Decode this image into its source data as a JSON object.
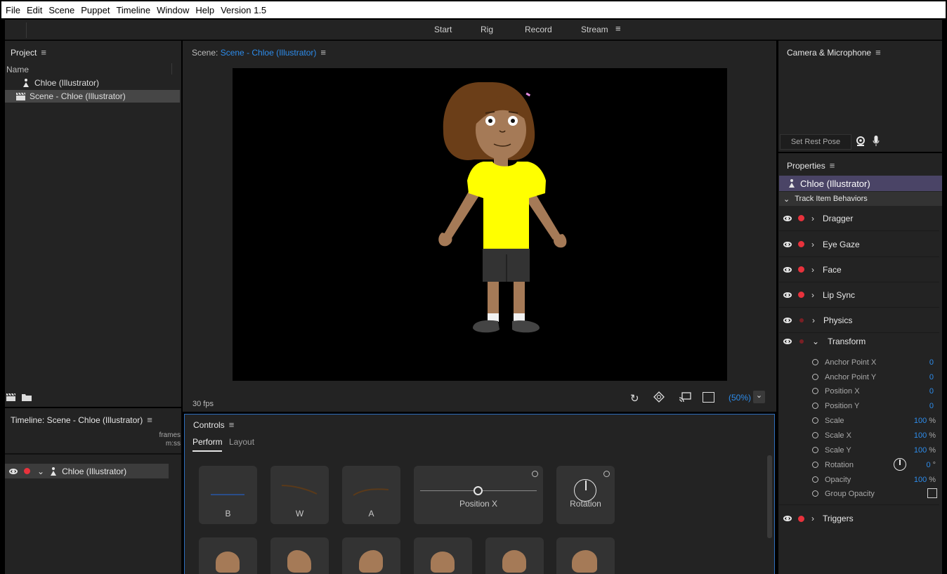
{
  "menubar": {
    "items": [
      "File",
      "Edit",
      "Scene",
      "Puppet",
      "Timeline",
      "Window",
      "Help",
      "Version 1.5"
    ]
  },
  "modes": {
    "start": "Start",
    "rig": "Rig",
    "record": "Record",
    "stream": "Stream"
  },
  "project": {
    "title": "Project",
    "column_name": "Name",
    "items": [
      {
        "label": "Chloe (Illustrator)",
        "icon": "puppet-icon"
      },
      {
        "label": "Scene - Chloe (Illustrator)",
        "icon": "scene-clapper-icon",
        "selected": true
      }
    ]
  },
  "scene": {
    "title_prefix": "Scene:",
    "title_name": "Scene - Chloe (Illustrator)",
    "fps": "30 fps",
    "zoom": "(50%)"
  },
  "timeline": {
    "title": "Timeline: Scene - Chloe (Illustrator)",
    "units_top": "frames",
    "units_bottom": "m:ss",
    "track_label": "Chloe (Illustrator)"
  },
  "controls": {
    "title": "Controls",
    "tabs": [
      "Perform",
      "Layout"
    ],
    "active_tab": "Perform",
    "tiles": [
      {
        "label": "B"
      },
      {
        "label": "W"
      },
      {
        "label": "A"
      },
      {
        "label": "Position X"
      },
      {
        "label": "Rotation"
      }
    ]
  },
  "camera": {
    "title": "Camera & Microphone",
    "rest_pose_button": "Set Rest Pose"
  },
  "properties": {
    "title": "Properties",
    "selected_puppet": "Chloe (Illustrator)",
    "section": "Track Item Behaviors",
    "behaviors": [
      "Dragger",
      "Eye Gaze",
      "Face",
      "Lip Sync",
      "Physics",
      "Transform",
      "Triggers"
    ],
    "transform_params": [
      {
        "name": "Anchor Point X",
        "value": "0",
        "unit": ""
      },
      {
        "name": "Anchor Point Y",
        "value": "0",
        "unit": ""
      },
      {
        "name": "Position X",
        "value": "0",
        "unit": ""
      },
      {
        "name": "Position Y",
        "value": "0",
        "unit": ""
      },
      {
        "name": "Scale",
        "value": "100",
        "unit": "%"
      },
      {
        "name": "Scale X",
        "value": "100",
        "unit": "%"
      },
      {
        "name": "Scale Y",
        "value": "100",
        "unit": "%"
      },
      {
        "name": "Rotation",
        "value": "0",
        "unit": "°"
      },
      {
        "name": "Opacity",
        "value": "100",
        "unit": "%"
      },
      {
        "name": "Group Opacity",
        "value": "",
        "unit": ""
      }
    ]
  },
  "colors": {
    "accent_blue": "#2d8ceb",
    "record_red": "#e8323c",
    "puppet_header": "#4a4466",
    "shirt": "#ffff00"
  }
}
